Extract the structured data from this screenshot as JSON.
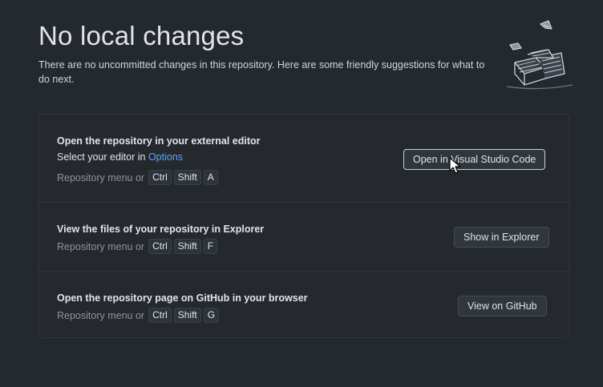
{
  "header": {
    "title": "No local changes",
    "description": "There are no uncommitted changes in this repository. Here are some friendly suggestions for what to do next."
  },
  "suggestions": [
    {
      "title": "Open the repository in your external editor",
      "subtitle_prefix": "Select your editor in ",
      "subtitle_link": "Options",
      "shortcut_lead": "Repository menu or",
      "keys": [
        "Ctrl",
        "Shift",
        "A"
      ],
      "button": "Open in Visual Studio Code"
    },
    {
      "title": "View the files of your repository in Explorer",
      "shortcut_lead": "Repository menu or",
      "keys": [
        "Ctrl",
        "Shift",
        "F"
      ],
      "button": "Show in Explorer"
    },
    {
      "title": "Open the repository page on GitHub in your browser",
      "shortcut_lead": "Repository menu or",
      "keys": [
        "Ctrl",
        "Shift",
        "G"
      ],
      "button": "View on GitHub"
    }
  ],
  "colors": {
    "background": "#24292e",
    "link": "#58a6ff",
    "border": "#30363d"
  },
  "icons": {
    "illustration": "papers-stack-illustration",
    "cursor": "mouse-pointer-icon"
  }
}
